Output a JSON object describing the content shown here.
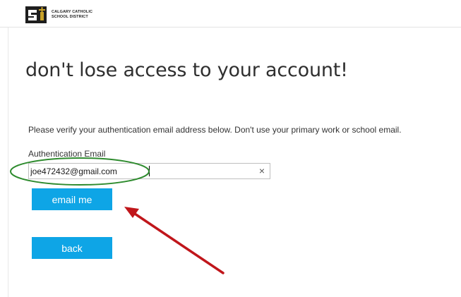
{
  "header": {
    "logo_line1": "CALGARY CATHOLIC",
    "logo_line2": "SCHOOL DISTRICT",
    "logo_icon": "calgary-catholic-logo-icon"
  },
  "main": {
    "heading": "don't lose access to your account!",
    "instructions": "Please verify your authentication email address below. Don't use your primary work or school email.",
    "field_label": "Authentication Email",
    "email_value": "joe472432@gmail.com",
    "clear_glyph": "×",
    "email_button_label": "email me",
    "back_button_label": "back"
  },
  "annotations": {
    "highlight_color": "#2e8b2e",
    "arrow_color": "#c0161b"
  },
  "colors": {
    "button": "#0ea5e6",
    "button_text": "#ffffff",
    "heading_text": "#2f2f2f"
  }
}
